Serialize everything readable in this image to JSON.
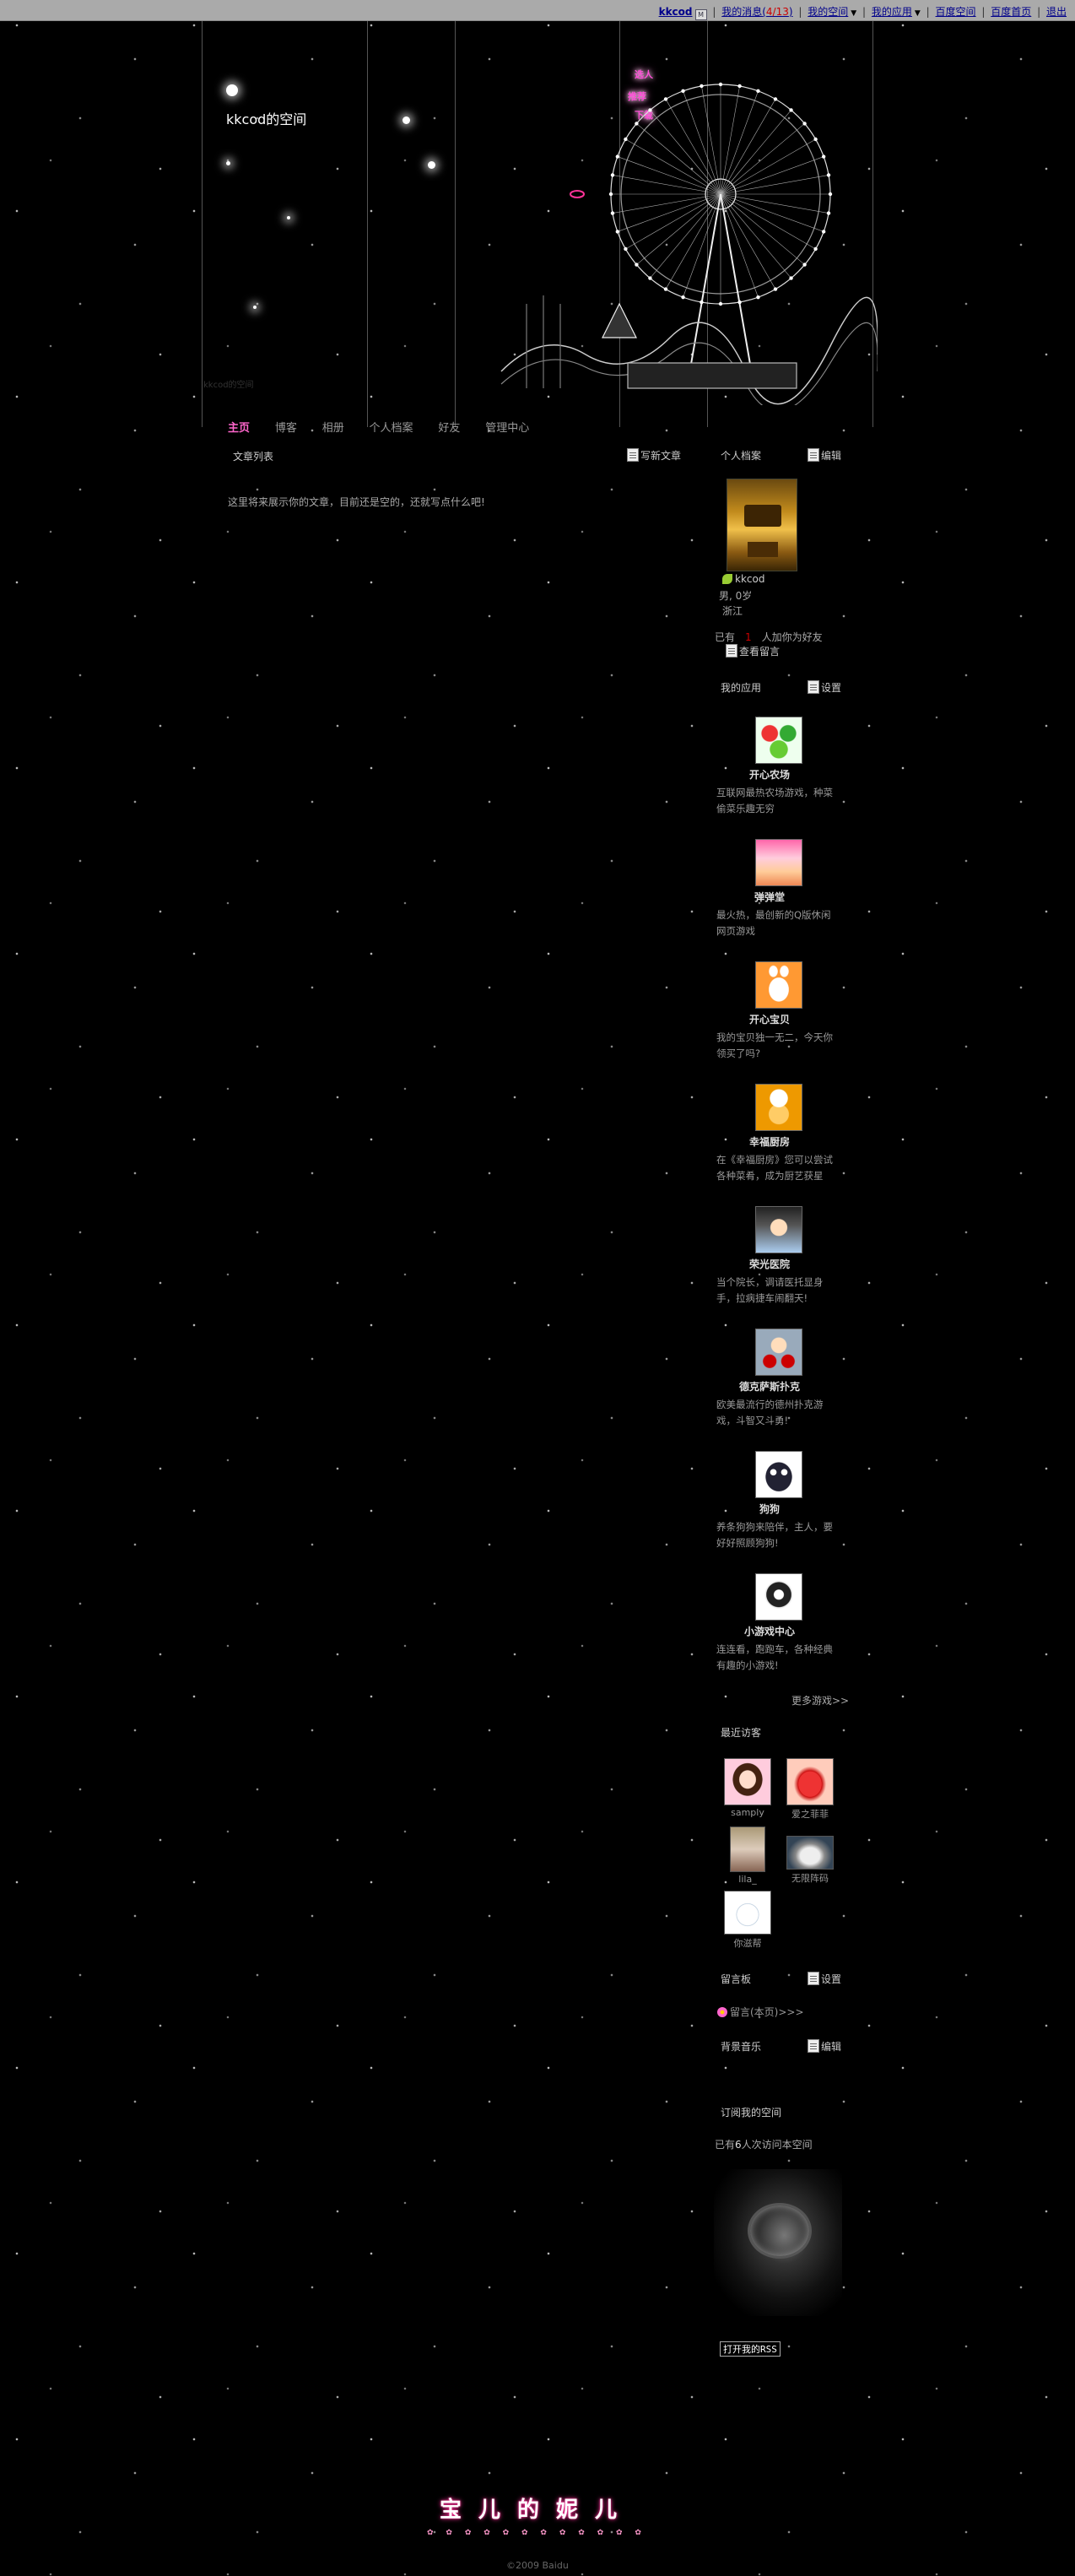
{
  "topbar": {
    "user": "kkcod",
    "messages_prefix": "我的消息",
    "messages_count": "4/13",
    "my_space": "我的空间",
    "my_apps": "我的应用",
    "baidu_space": "百度空间",
    "baidu_home": "百度首页",
    "logout": "退出"
  },
  "header": {
    "title": "kkcod的空间",
    "url": "kkcod的空间",
    "menu_labels": [
      "选人",
      "推荐",
      "下载"
    ]
  },
  "nav": [
    "主页",
    "博客",
    "相册",
    "个人档案",
    "好友",
    "管理中心"
  ],
  "main": {
    "section_title": "文章列表",
    "write_post": "写新文章",
    "empty_message": "这里将来展示你的文章，目前还是空的，还就写点什么吧!"
  },
  "profile": {
    "title": "个人档案",
    "edit": "编辑",
    "name": "kkcod",
    "gender_age": "男, 0岁",
    "location": "浙江",
    "friends_prefix": "已有",
    "friends_count": "1",
    "friends_suffix": "人加你为好友",
    "view_messages": "查看留言"
  },
  "apps": {
    "title": "我的应用",
    "settings": "设置",
    "items": [
      {
        "name": "开心农场",
        "desc": "互联网最热农场游戏，种菜偷菜乐趣无穷",
        "icon": "farm-app-icon"
      },
      {
        "name": "弹弹堂",
        "desc": "最火热，最创新的Q版休闲网页游戏",
        "icon": "ddt-app-icon"
      },
      {
        "name": "开心宝贝",
        "desc": "我的宝贝独一无二，今天你领买了吗?",
        "icon": "bunny-app-icon"
      },
      {
        "name": "幸福厨房",
        "desc": "在《幸福厨房》您可以尝试各种菜肴，成为厨艺获星",
        "icon": "chef-app-icon"
      },
      {
        "name": "荣光医院",
        "desc": "当个院长，调请医托显身手，拉病捷车闹翻天!",
        "icon": "hospital-app-icon"
      },
      {
        "name": "德克萨斯扑克",
        "desc": "欧美最流行的德州扑克游戏，斗智又斗勇!",
        "icon": "poker-app-icon"
      },
      {
        "name": "狗狗",
        "desc": "养条狗狗来陪伴，主人，要好好照顾狗狗!",
        "icon": "dog-app-icon"
      },
      {
        "name": "小游戏中心",
        "desc": "连连看，跑跑车，各种经典有趣的小游戏!",
        "icon": "games-app-icon"
      }
    ],
    "more": "更多游戏>>"
  },
  "visitors": {
    "title": "最近访客",
    "items": [
      {
        "name": "samply"
      },
      {
        "name": "爱之菲菲"
      },
      {
        "name": "lila_"
      },
      {
        "name": "无限阵码"
      },
      {
        "name": "你滋帮"
      }
    ]
  },
  "guestbook": {
    "title": "留言板",
    "settings": "设置",
    "link": "留言(本页)>>>"
  },
  "music": {
    "title": "背景音乐",
    "edit": "编辑"
  },
  "subscribe": {
    "title": "订阅我的空间",
    "visit_prefix": "已有",
    "visit_count": "6",
    "visit_suffix": "人次访问本空间",
    "counter": "打开我的RSS"
  },
  "footer": {
    "logo_chars": [
      "宝",
      "儿",
      "的",
      "妮",
      "儿"
    ],
    "copyright": "©2009 Baidu"
  }
}
